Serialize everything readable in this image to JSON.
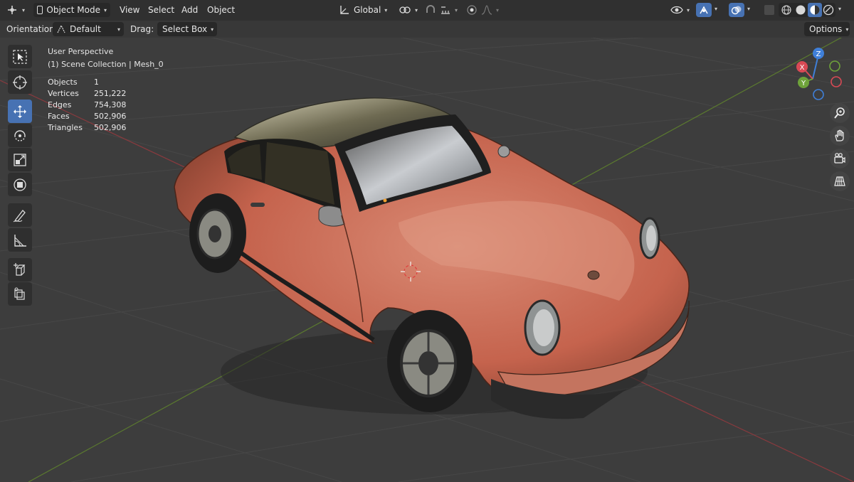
{
  "header": {
    "mode_label": "Object Mode",
    "menu": [
      "View",
      "Select",
      "Add",
      "Object"
    ],
    "transform_orientation": "Global",
    "icons": [
      "editor-type-icon",
      "object-mode-icon",
      "transform-pivot-icon",
      "snap-icon",
      "proportional-edit-icon",
      "visibility-icon",
      "gizmo-icon",
      "overlay-icon",
      "xray-icon",
      "shading-wireframe",
      "shading-solid",
      "shading-material",
      "shading-rendered"
    ]
  },
  "tool_settings": {
    "orientation_label": "Orientation:",
    "orientation_value": "Default",
    "drag_label": "Drag:",
    "drag_value": "Select Box",
    "options_label": "Options"
  },
  "overlay": {
    "view_name": "User Perspective",
    "collection": "(1) Scene Collection | Mesh_0",
    "stats": [
      {
        "label": "Objects",
        "value": "1"
      },
      {
        "label": "Vertices",
        "value": "251,222"
      },
      {
        "label": "Edges",
        "value": "754,308"
      },
      {
        "label": "Faces",
        "value": "502,906"
      },
      {
        "label": "Triangles",
        "value": "502,906"
      }
    ]
  },
  "toolbar": {
    "tools": [
      "select-box-tool",
      "cursor-tool",
      "move-tool",
      "rotate-tool",
      "scale-tool",
      "transform-tool",
      "annotate-tool",
      "measure-tool",
      "add-cube-tool",
      "extrude-tool"
    ],
    "active_tool": "move-tool"
  },
  "gizmo": {
    "z_label": "Z",
    "x_label": "X",
    "y_label": "Y",
    "axis_colors": {
      "x": "#d94a55",
      "y": "#6ea23a",
      "z": "#3f7fd8"
    }
  },
  "nav_buttons": [
    "zoom-icon",
    "pan-hand-icon",
    "camera-icon",
    "grid-view-icon"
  ],
  "scene": {
    "object": "Mesh_0",
    "body_color": "#c5634d"
  }
}
